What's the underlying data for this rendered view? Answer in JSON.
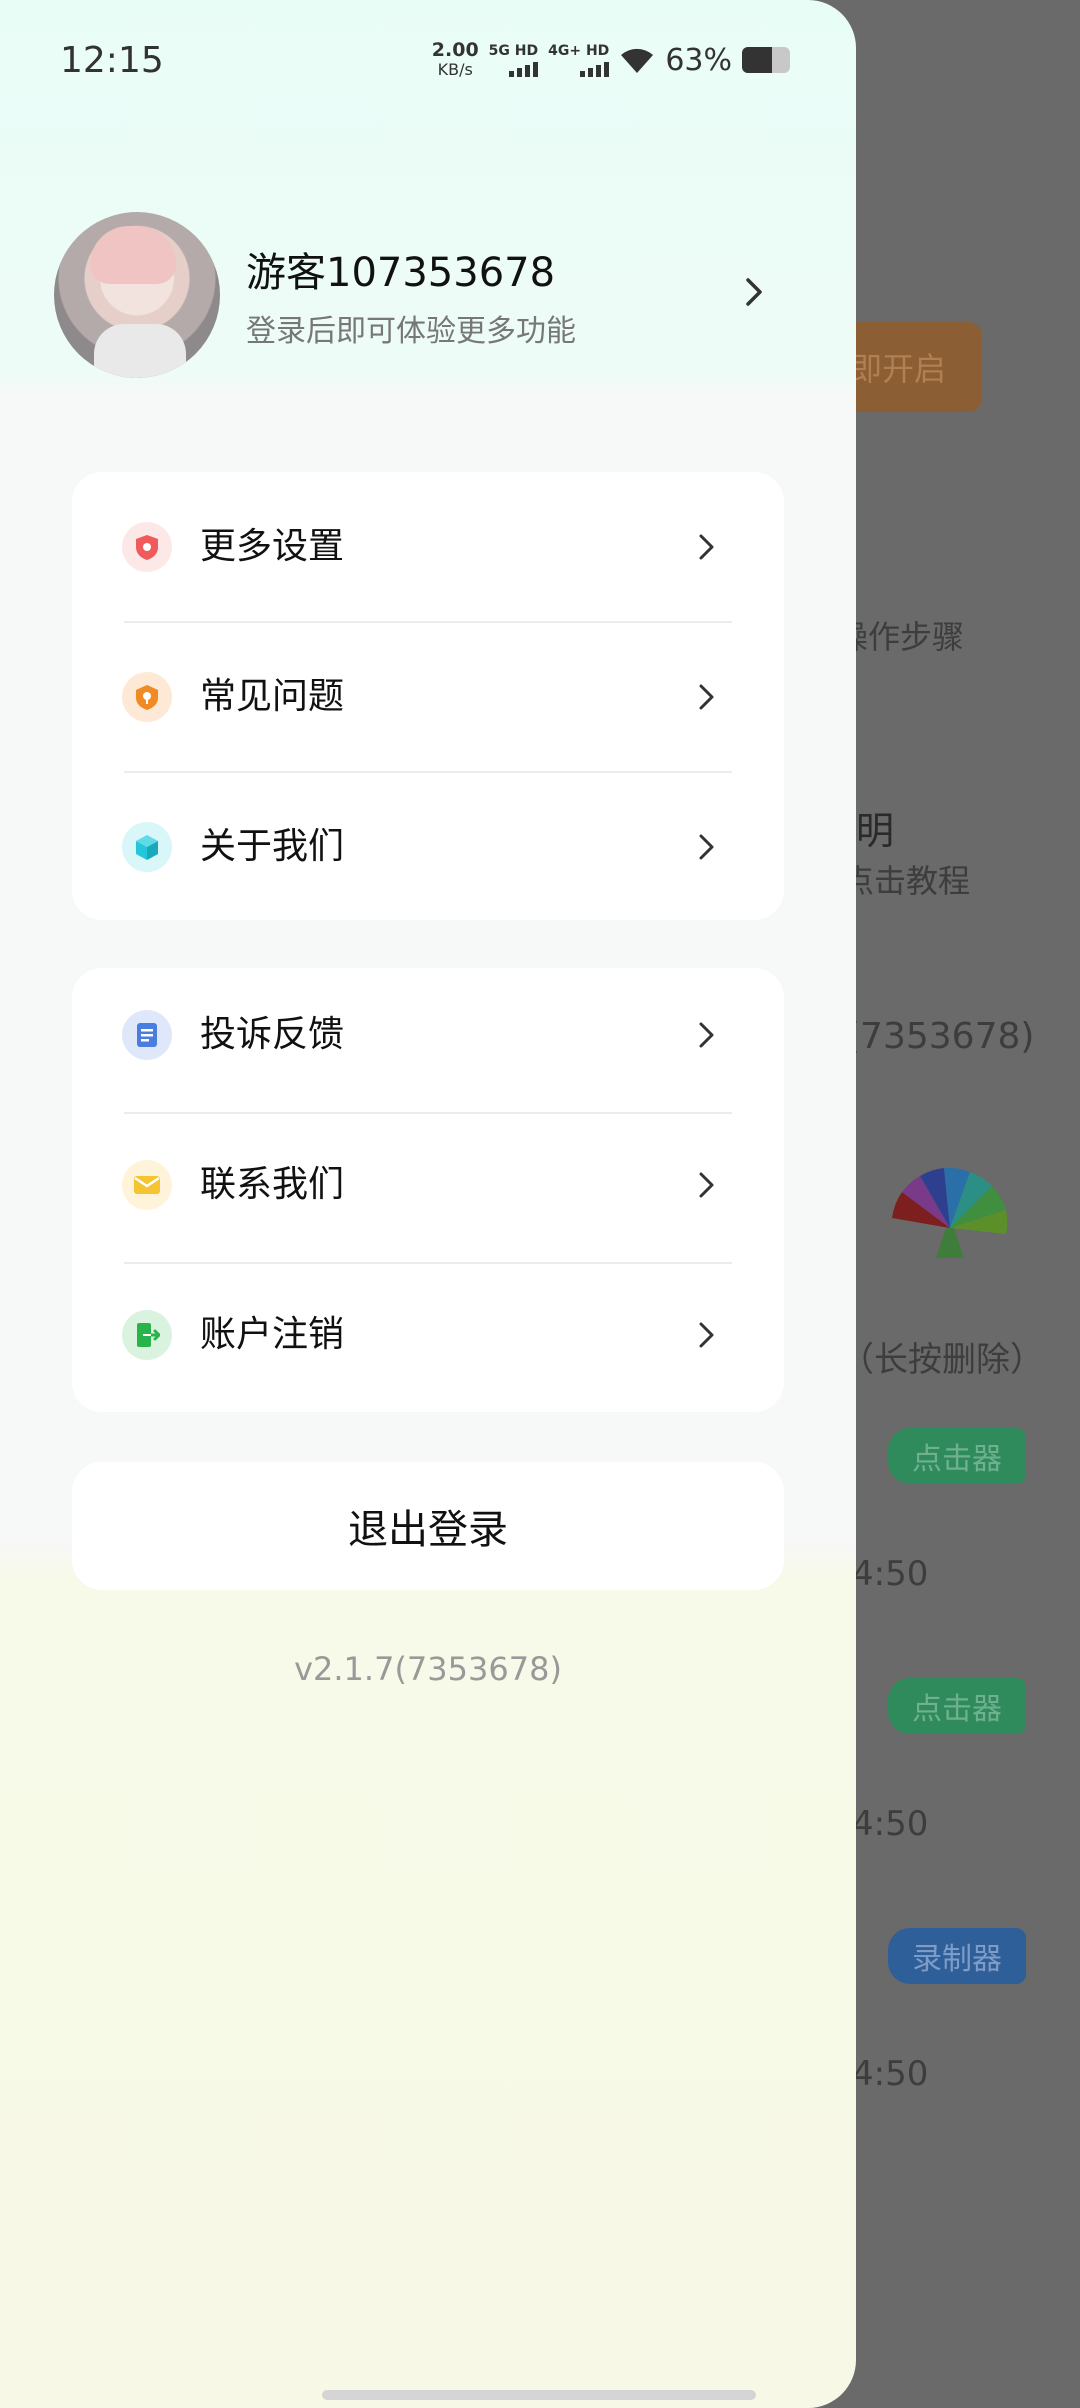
{
  "status_bar": {
    "time": "12:15",
    "net_speed_value": "2.00",
    "net_speed_unit": "KB/s",
    "sim1": "5G HD",
    "sim2": "4G+ HD",
    "battery": "63%",
    "battery_level": 0.63
  },
  "profile": {
    "username": "游客107353678",
    "subtitle": "登录后即可体验更多功能"
  },
  "menu_group_1": [
    {
      "label": "更多设置",
      "icon": "shield-settings-icon",
      "color": "#f15a5a"
    },
    {
      "label": "常见问题",
      "icon": "question-shield-icon",
      "color": "#f08a24"
    },
    {
      "label": "关于我们",
      "icon": "cube-icon",
      "color": "#26c6da"
    }
  ],
  "menu_group_2": [
    {
      "label": "投诉反馈",
      "icon": "document-icon",
      "color": "#4a7de0"
    },
    {
      "label": "联系我们",
      "icon": "mail-icon",
      "color": "#f4c531"
    },
    {
      "label": "账户注销",
      "icon": "exit-door-icon",
      "color": "#2ab34a"
    }
  ],
  "logout_label": "退出登录",
  "version": "v2.1.7(7353678)",
  "background": {
    "button_text": "即开启",
    "step_text": "操作步骤",
    "heading_fragment": "明",
    "tutorial_text": "点击教程",
    "version_fragment": "(7353678)",
    "list_header": "（长按删除）",
    "tag_clicker": "点击器",
    "tag_recorder": "录制器",
    "time_fragment": "4:50"
  }
}
